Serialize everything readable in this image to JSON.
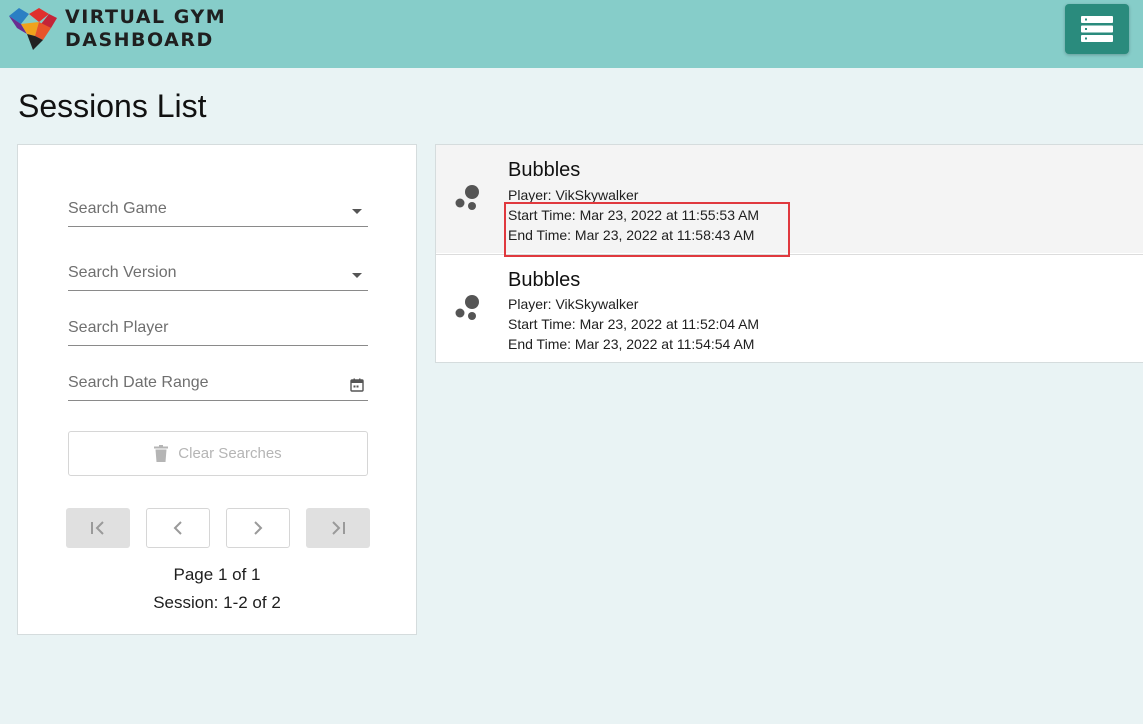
{
  "header": {
    "brand_line1": "VIRTUAL GYM",
    "brand_line2": "DASHBOARD",
    "logo_icon": "heart-logo-icon",
    "menu_icon": "server-list-icon",
    "bar_color": "#86cdc9",
    "menu_color": "#2a8b7d"
  },
  "page": {
    "title": "Sessions List"
  },
  "filters": {
    "game_placeholder": "Search Game",
    "version_placeholder": "Search Version",
    "player_placeholder": "Search Player",
    "date_placeholder": "Search Date Range",
    "clear_label": "Clear Searches"
  },
  "pagination": {
    "page_text": "Page 1 of 1",
    "session_text": "Session: 1-2 of 2"
  },
  "sessions": [
    {
      "title": "Bubbles",
      "player": "Player: VikSkywalker",
      "start": "Start Time: Mar 23, 2022 at 11:55:53 AM",
      "end": "End Time: Mar 23, 2022 at 11:58:43 AM",
      "icon": "bubbles-icon"
    },
    {
      "title": "Bubbles",
      "player": "Player: VikSkywalker",
      "start": "Start Time: Mar 23, 2022 at 11:52:04 AM",
      "end": "End Time: Mar 23, 2022 at 11:54:54 AM",
      "icon": "bubbles-icon"
    }
  ],
  "annotation": {
    "color": "#e0393e"
  }
}
